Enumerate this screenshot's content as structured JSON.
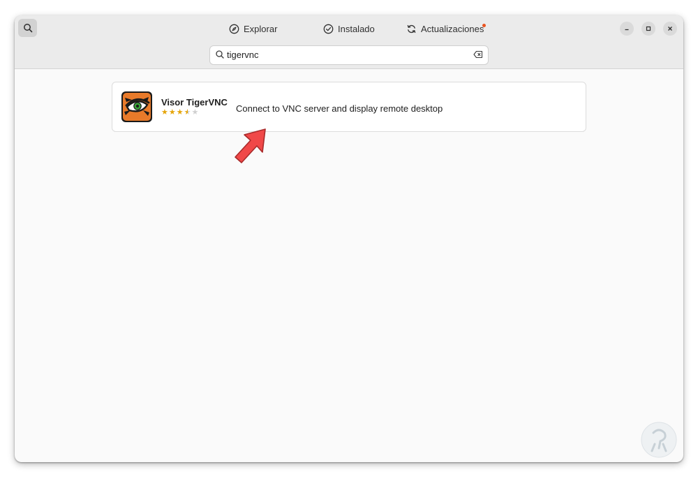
{
  "header": {
    "tabs": [
      {
        "label": "Explorar",
        "icon": "compass-icon"
      },
      {
        "label": "Instalado",
        "icon": "check-circle-icon"
      },
      {
        "label": "Actualizaciones",
        "icon": "refresh-icon",
        "has_notification": true
      }
    ]
  },
  "search": {
    "value": "tigervnc",
    "placeholder": ""
  },
  "results": [
    {
      "name": "Visor TigerVNC",
      "description": "Connect to VNC server and display remote desktop",
      "rating": 3.5,
      "rating_max": 5,
      "icon": "tigervnc-app-icon"
    }
  ],
  "colors": {
    "accent": "#e95420",
    "star": "#e5a50a",
    "star_empty": "#d0d0d0",
    "arrow": "#f04848"
  }
}
